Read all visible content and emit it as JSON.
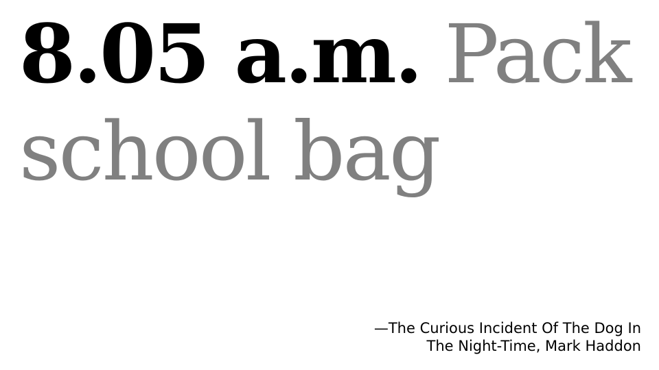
{
  "quote": {
    "time": "8.05 a.m.",
    "text": "Pack school bag"
  },
  "attribution": {
    "line1": "—The Curious Incident Of The Dog In",
    "line2": "The Night-Time, Mark Haddon"
  },
  "colors": {
    "time": "#000000",
    "text": "#808080",
    "attribution": "#000000",
    "background": "#ffffff"
  }
}
